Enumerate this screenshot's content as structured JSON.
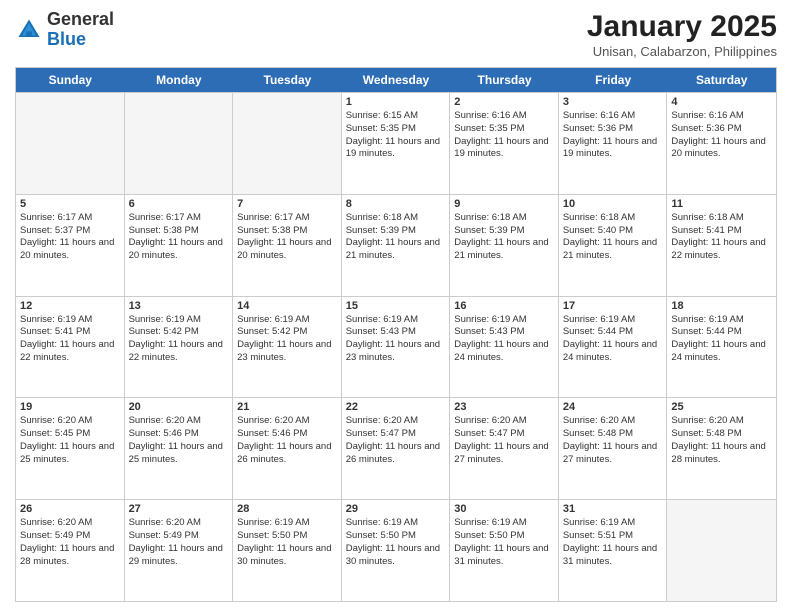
{
  "header": {
    "logo_general": "General",
    "logo_blue": "Blue",
    "month_title": "January 2025",
    "subtitle": "Unisan, Calabarzon, Philippines"
  },
  "day_headers": [
    "Sunday",
    "Monday",
    "Tuesday",
    "Wednesday",
    "Thursday",
    "Friday",
    "Saturday"
  ],
  "weeks": [
    [
      {
        "day": "",
        "sunrise": "",
        "sunset": "",
        "daylight": "",
        "empty": true
      },
      {
        "day": "",
        "sunrise": "",
        "sunset": "",
        "daylight": "",
        "empty": true
      },
      {
        "day": "",
        "sunrise": "",
        "sunset": "",
        "daylight": "",
        "empty": true
      },
      {
        "day": "1",
        "sunrise": "Sunrise: 6:15 AM",
        "sunset": "Sunset: 5:35 PM",
        "daylight": "Daylight: 11 hours and 19 minutes.",
        "empty": false
      },
      {
        "day": "2",
        "sunrise": "Sunrise: 6:16 AM",
        "sunset": "Sunset: 5:35 PM",
        "daylight": "Daylight: 11 hours and 19 minutes.",
        "empty": false
      },
      {
        "day": "3",
        "sunrise": "Sunrise: 6:16 AM",
        "sunset": "Sunset: 5:36 PM",
        "daylight": "Daylight: 11 hours and 19 minutes.",
        "empty": false
      },
      {
        "day": "4",
        "sunrise": "Sunrise: 6:16 AM",
        "sunset": "Sunset: 5:36 PM",
        "daylight": "Daylight: 11 hours and 20 minutes.",
        "empty": false
      }
    ],
    [
      {
        "day": "5",
        "sunrise": "Sunrise: 6:17 AM",
        "sunset": "Sunset: 5:37 PM",
        "daylight": "Daylight: 11 hours and 20 minutes.",
        "empty": false
      },
      {
        "day": "6",
        "sunrise": "Sunrise: 6:17 AM",
        "sunset": "Sunset: 5:38 PM",
        "daylight": "Daylight: 11 hours and 20 minutes.",
        "empty": false
      },
      {
        "day": "7",
        "sunrise": "Sunrise: 6:17 AM",
        "sunset": "Sunset: 5:38 PM",
        "daylight": "Daylight: 11 hours and 20 minutes.",
        "empty": false
      },
      {
        "day": "8",
        "sunrise": "Sunrise: 6:18 AM",
        "sunset": "Sunset: 5:39 PM",
        "daylight": "Daylight: 11 hours and 21 minutes.",
        "empty": false
      },
      {
        "day": "9",
        "sunrise": "Sunrise: 6:18 AM",
        "sunset": "Sunset: 5:39 PM",
        "daylight": "Daylight: 11 hours and 21 minutes.",
        "empty": false
      },
      {
        "day": "10",
        "sunrise": "Sunrise: 6:18 AM",
        "sunset": "Sunset: 5:40 PM",
        "daylight": "Daylight: 11 hours and 21 minutes.",
        "empty": false
      },
      {
        "day": "11",
        "sunrise": "Sunrise: 6:18 AM",
        "sunset": "Sunset: 5:41 PM",
        "daylight": "Daylight: 11 hours and 22 minutes.",
        "empty": false
      }
    ],
    [
      {
        "day": "12",
        "sunrise": "Sunrise: 6:19 AM",
        "sunset": "Sunset: 5:41 PM",
        "daylight": "Daylight: 11 hours and 22 minutes.",
        "empty": false
      },
      {
        "day": "13",
        "sunrise": "Sunrise: 6:19 AM",
        "sunset": "Sunset: 5:42 PM",
        "daylight": "Daylight: 11 hours and 22 minutes.",
        "empty": false
      },
      {
        "day": "14",
        "sunrise": "Sunrise: 6:19 AM",
        "sunset": "Sunset: 5:42 PM",
        "daylight": "Daylight: 11 hours and 23 minutes.",
        "empty": false
      },
      {
        "day": "15",
        "sunrise": "Sunrise: 6:19 AM",
        "sunset": "Sunset: 5:43 PM",
        "daylight": "Daylight: 11 hours and 23 minutes.",
        "empty": false
      },
      {
        "day": "16",
        "sunrise": "Sunrise: 6:19 AM",
        "sunset": "Sunset: 5:43 PM",
        "daylight": "Daylight: 11 hours and 24 minutes.",
        "empty": false
      },
      {
        "day": "17",
        "sunrise": "Sunrise: 6:19 AM",
        "sunset": "Sunset: 5:44 PM",
        "daylight": "Daylight: 11 hours and 24 minutes.",
        "empty": false
      },
      {
        "day": "18",
        "sunrise": "Sunrise: 6:19 AM",
        "sunset": "Sunset: 5:44 PM",
        "daylight": "Daylight: 11 hours and 24 minutes.",
        "empty": false
      }
    ],
    [
      {
        "day": "19",
        "sunrise": "Sunrise: 6:20 AM",
        "sunset": "Sunset: 5:45 PM",
        "daylight": "Daylight: 11 hours and 25 minutes.",
        "empty": false
      },
      {
        "day": "20",
        "sunrise": "Sunrise: 6:20 AM",
        "sunset": "Sunset: 5:46 PM",
        "daylight": "Daylight: 11 hours and 25 minutes.",
        "empty": false
      },
      {
        "day": "21",
        "sunrise": "Sunrise: 6:20 AM",
        "sunset": "Sunset: 5:46 PM",
        "daylight": "Daylight: 11 hours and 26 minutes.",
        "empty": false
      },
      {
        "day": "22",
        "sunrise": "Sunrise: 6:20 AM",
        "sunset": "Sunset: 5:47 PM",
        "daylight": "Daylight: 11 hours and 26 minutes.",
        "empty": false
      },
      {
        "day": "23",
        "sunrise": "Sunrise: 6:20 AM",
        "sunset": "Sunset: 5:47 PM",
        "daylight": "Daylight: 11 hours and 27 minutes.",
        "empty": false
      },
      {
        "day": "24",
        "sunrise": "Sunrise: 6:20 AM",
        "sunset": "Sunset: 5:48 PM",
        "daylight": "Daylight: 11 hours and 27 minutes.",
        "empty": false
      },
      {
        "day": "25",
        "sunrise": "Sunrise: 6:20 AM",
        "sunset": "Sunset: 5:48 PM",
        "daylight": "Daylight: 11 hours and 28 minutes.",
        "empty": false
      }
    ],
    [
      {
        "day": "26",
        "sunrise": "Sunrise: 6:20 AM",
        "sunset": "Sunset: 5:49 PM",
        "daylight": "Daylight: 11 hours and 28 minutes.",
        "empty": false
      },
      {
        "day": "27",
        "sunrise": "Sunrise: 6:20 AM",
        "sunset": "Sunset: 5:49 PM",
        "daylight": "Daylight: 11 hours and 29 minutes.",
        "empty": false
      },
      {
        "day": "28",
        "sunrise": "Sunrise: 6:19 AM",
        "sunset": "Sunset: 5:50 PM",
        "daylight": "Daylight: 11 hours and 30 minutes.",
        "empty": false
      },
      {
        "day": "29",
        "sunrise": "Sunrise: 6:19 AM",
        "sunset": "Sunset: 5:50 PM",
        "daylight": "Daylight: 11 hours and 30 minutes.",
        "empty": false
      },
      {
        "day": "30",
        "sunrise": "Sunrise: 6:19 AM",
        "sunset": "Sunset: 5:50 PM",
        "daylight": "Daylight: 11 hours and 31 minutes.",
        "empty": false
      },
      {
        "day": "31",
        "sunrise": "Sunrise: 6:19 AM",
        "sunset": "Sunset: 5:51 PM",
        "daylight": "Daylight: 11 hours and 31 minutes.",
        "empty": false
      },
      {
        "day": "",
        "sunrise": "",
        "sunset": "",
        "daylight": "",
        "empty": true
      }
    ]
  ]
}
